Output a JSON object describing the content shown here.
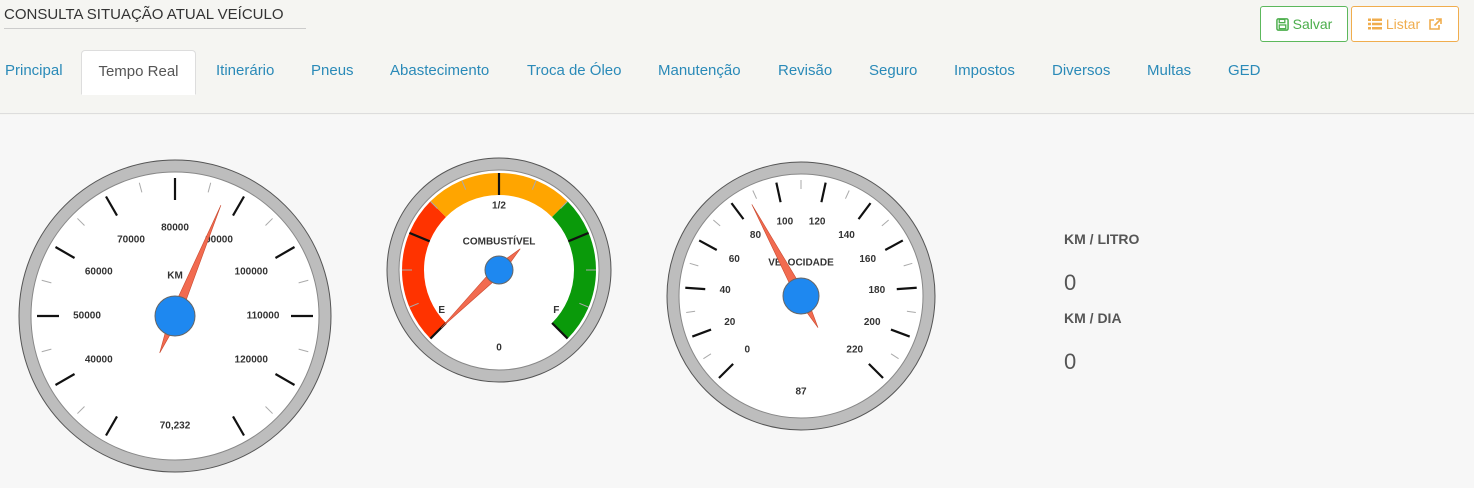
{
  "header": {
    "title": "CONSULTA SITUAÇÃO ATUAL VEÍCULO",
    "save_label": "Salvar",
    "list_label": "Listar",
    "save_color": "#5cb85c",
    "list_color": "#f0ad4e"
  },
  "tabs": [
    {
      "label": "Principal"
    },
    {
      "label": "Tempo Real"
    },
    {
      "label": "Itinerário"
    },
    {
      "label": "Pneus"
    },
    {
      "label": "Abastecimento"
    },
    {
      "label": "Troca de Óleo"
    },
    {
      "label": "Manutenção"
    },
    {
      "label": "Revisão"
    },
    {
      "label": "Seguro"
    },
    {
      "label": "Impostos"
    },
    {
      "label": "Diversos"
    },
    {
      "label": "Multas"
    },
    {
      "label": "GED"
    }
  ],
  "active_tab": "Tempo Real",
  "odometer": {
    "unit": "KM",
    "labels": [
      "40000",
      "50000",
      "60000",
      "70000",
      "80000",
      "90000",
      "100000",
      "110000",
      "120000"
    ],
    "min": 30000,
    "max": 130000,
    "value": 87500,
    "reading": "70,232",
    "needle_color": "#f26b50",
    "hub_color": "#1e88f0"
  },
  "fuel": {
    "title": "COMBUSTÍVEL",
    "half_label": "1/2",
    "empty_label": "E",
    "full_label": "F",
    "reading": "0",
    "level": 0,
    "zone_colors": [
      "#ff3300",
      "#ffa500",
      "#0a9a0a"
    ]
  },
  "speed": {
    "title": "VELOCIDADE",
    "labels": [
      "0",
      "20",
      "40",
      "60",
      "80",
      "100",
      "120",
      "140",
      "160",
      "180",
      "200",
      "220"
    ],
    "min": 0,
    "max": 220,
    "value": 87,
    "reading": "87"
  },
  "stats": {
    "km_litro_label": "KM / LITRO",
    "km_litro_value": "0",
    "km_dia_label": "KM / DIA",
    "km_dia_value": "0"
  }
}
